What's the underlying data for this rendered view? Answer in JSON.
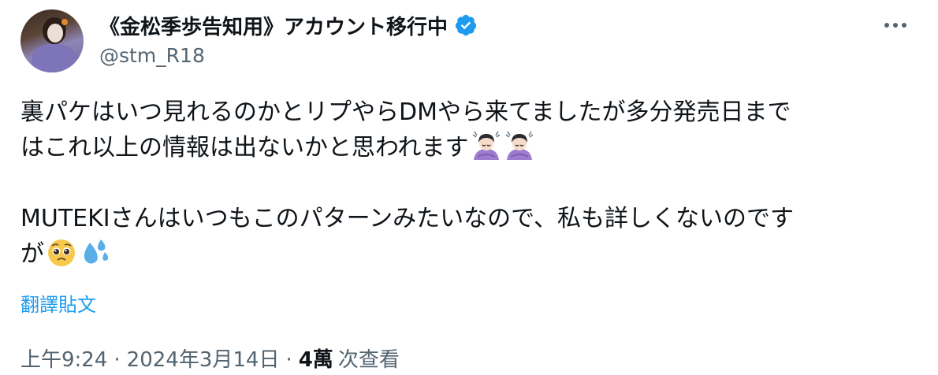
{
  "author": {
    "display_name": "《金松季歩告知用》アカウント移行中",
    "handle": "@stm_R18",
    "verified": true
  },
  "tweet": {
    "line1": "裏パケはいつ見れるのかとリプやらDMやら来てましたが多分発売日まで",
    "line2": "はこれ以上の情報は出ないかと思われます",
    "line3": "MUTEKIさんはいつもこのパターンみたいなので、私も詳しくないのです",
    "line4": "が",
    "emojis": [
      "person-bowing-emoji",
      "person-bowing-emoji",
      "pleading-face-emoji",
      "sweat-droplets-emoji"
    ]
  },
  "translate_label": "翻譯貼文",
  "meta": {
    "time": "上午9:24",
    "separator": "·",
    "date": "2024年3月14日",
    "views_count": "4萬",
    "views_label": "次查看"
  },
  "colors": {
    "link": "#1d9bf0",
    "secondary": "#536471",
    "primary_text": "#0f1419",
    "verified_badge": "#1d9bf0"
  }
}
